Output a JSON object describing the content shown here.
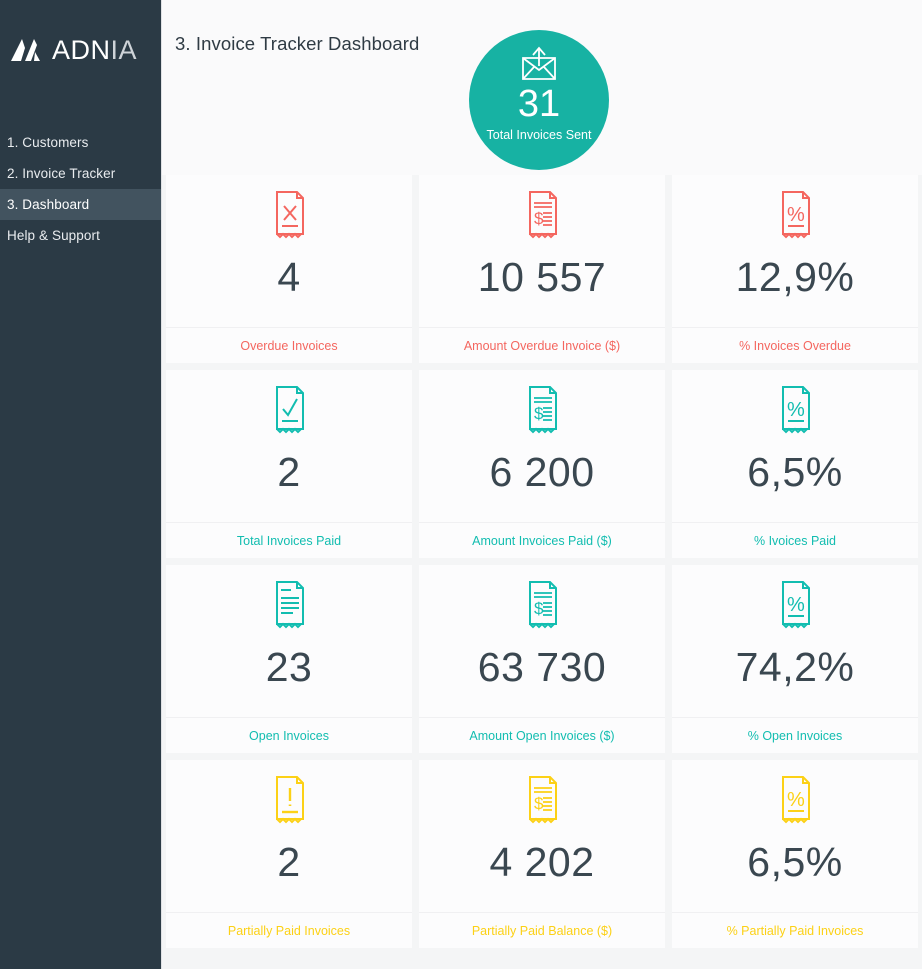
{
  "sidebar": {
    "logo": {
      "mark": "adnia-logo-mark",
      "text_bold": "ADN",
      "text_light": "IA"
    },
    "items": [
      {
        "label": "1. Customers",
        "active": false
      },
      {
        "label": "2. Invoice Tracker",
        "active": false
      },
      {
        "label": "3. Dashboard",
        "active": true
      },
      {
        "label": "Help & Support",
        "active": false
      }
    ]
  },
  "header": {
    "title": "3. Invoice Tracker Dashboard",
    "hero": {
      "icon": "sent-envelope-icon",
      "value": "31",
      "label": "Total Invoices Sent",
      "color": "#17b2a3"
    }
  },
  "colors": {
    "overdue": "#f4665f",
    "paid": "#12bdb0",
    "open": "#12bdb0",
    "partial": "#fcd116",
    "value_text": "#3a4750",
    "sidebar_bg": "#2b3a45",
    "sidebar_active": "#42535f",
    "card_bg": "#fcfcfd",
    "main_bg": "#f4f5f6"
  },
  "cards": [
    {
      "color_key": "overdue",
      "color": "#f4665f",
      "items": [
        {
          "icon": "document-x-icon",
          "value": "4",
          "label": "Overdue Invoices"
        },
        {
          "icon": "invoice-dollar-icon",
          "value": "10 557",
          "label": "Amount Overdue Invoice ($)"
        },
        {
          "icon": "document-percent-icon",
          "value": "12,9%",
          "label": "% Invoices Overdue"
        }
      ]
    },
    {
      "color_key": "paid",
      "color": "#12bdb0",
      "items": [
        {
          "icon": "document-check-icon",
          "value": "2",
          "label": "Total Invoices Paid"
        },
        {
          "icon": "invoice-dollar-icon",
          "value": "6 200",
          "label": "Amount Invoices Paid ($)"
        },
        {
          "icon": "document-percent-icon",
          "value": "6,5%",
          "label": "% Ivoices Paid"
        }
      ]
    },
    {
      "color_key": "open",
      "color": "#12bdb0",
      "items": [
        {
          "icon": "document-lines-icon",
          "value": "23",
          "label": "Open Invoices"
        },
        {
          "icon": "invoice-dollar-icon",
          "value": "63 730",
          "label": "Amount Open Invoices ($)"
        },
        {
          "icon": "document-percent-icon",
          "value": "74,2%",
          "label": "% Open Invoices"
        }
      ]
    },
    {
      "color_key": "partial",
      "color": "#fcd116",
      "items": [
        {
          "icon": "document-exclamation-icon",
          "value": "2",
          "label": "Partially Paid Invoices"
        },
        {
          "icon": "invoice-dollar-icon",
          "value": "4 202",
          "label": "Partially Paid Balance ($)"
        },
        {
          "icon": "document-percent-icon",
          "value": "6,5%",
          "label": "% Partially Paid Invoices"
        }
      ]
    }
  ]
}
